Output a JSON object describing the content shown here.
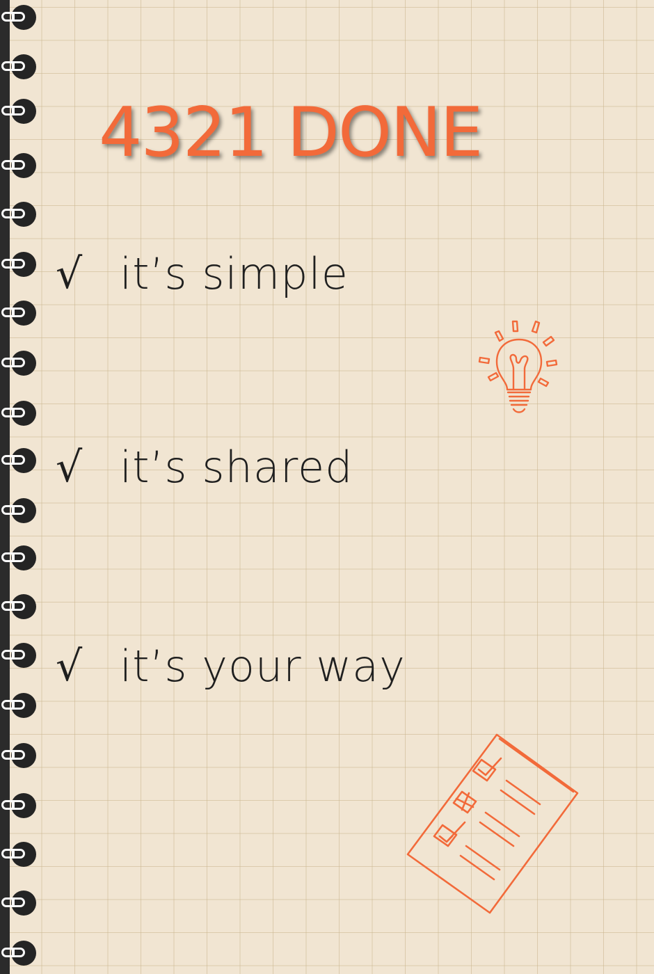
{
  "title": "4321 DONE",
  "items": [
    {
      "check": "√",
      "label": "it’s simple"
    },
    {
      "check": "√",
      "label": "it’s shared"
    },
    {
      "check": "√",
      "label": "it’s your way"
    }
  ],
  "icons": {
    "bulb": "lightbulb-icon",
    "clipboard": "checklist-clipboard-icon"
  },
  "colors": {
    "accent": "#f26a3a",
    "paper": "#f1e5d2",
    "ink": "#1f1f1f",
    "spine": "#2b2b2b"
  }
}
